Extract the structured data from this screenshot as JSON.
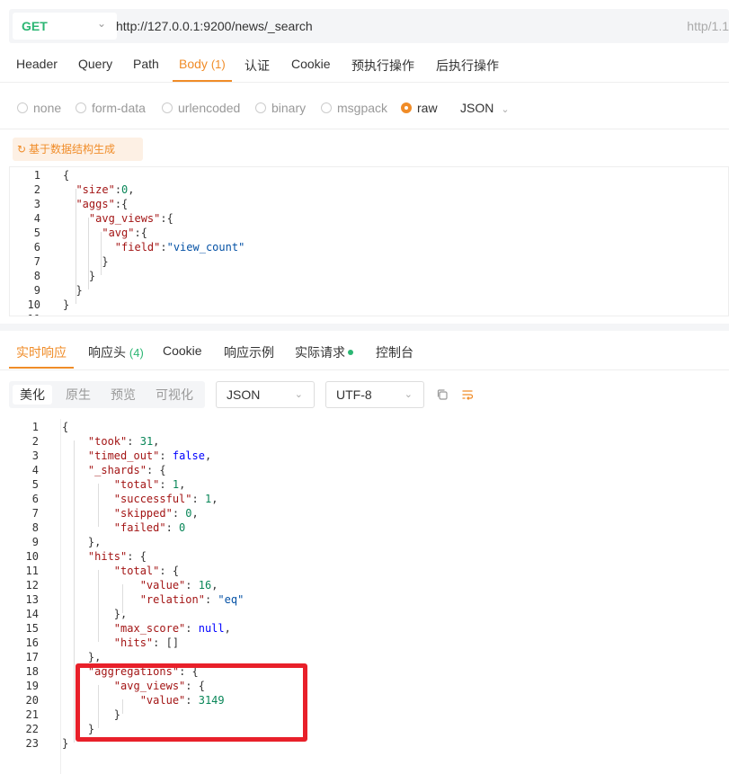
{
  "url_bar": {
    "method": "GET",
    "url": "http://127.0.0.1:9200/news/_search",
    "right_text": "http/1.1"
  },
  "request_tabs": [
    {
      "label": "Header",
      "count": ""
    },
    {
      "label": "Query",
      "count": ""
    },
    {
      "label": "Path",
      "count": ""
    },
    {
      "label": "Body",
      "count": "(1)"
    },
    {
      "label": "认证",
      "count": ""
    },
    {
      "label": "Cookie",
      "count": ""
    },
    {
      "label": "预执行操作",
      "count": ""
    },
    {
      "label": "后执行操作",
      "count": ""
    }
  ],
  "active_request_tab": "Body",
  "body_types": [
    "none",
    "form-data",
    "urlencoded",
    "binary",
    "msgpack",
    "raw"
  ],
  "selected_body_type": "raw",
  "raw_format": "JSON",
  "generate_button": "基于数据结构生成",
  "request_body": [
    {
      "n": "1",
      "t": [
        [
          "p",
          "{"
        ]
      ]
    },
    {
      "n": "2",
      "t": [
        [
          "p",
          "  "
        ],
        [
          "k",
          "\"size\""
        ],
        [
          "p",
          ":"
        ],
        [
          "n",
          "0"
        ],
        [
          "p",
          ","
        ]
      ]
    },
    {
      "n": "3",
      "t": [
        [
          "p",
          "  "
        ],
        [
          "k",
          "\"aggs\""
        ],
        [
          "p",
          ":{"
        ]
      ]
    },
    {
      "n": "4",
      "t": [
        [
          "p",
          "    "
        ],
        [
          "k",
          "\"avg_views\""
        ],
        [
          "p",
          ":{"
        ]
      ]
    },
    {
      "n": "5",
      "t": [
        [
          "p",
          "      "
        ],
        [
          "k",
          "\"avg\""
        ],
        [
          "p",
          ":{"
        ]
      ]
    },
    {
      "n": "6",
      "t": [
        [
          "p",
          "        "
        ],
        [
          "k",
          "\"field\""
        ],
        [
          "p",
          ":"
        ],
        [
          "s",
          "\"view_count\""
        ]
      ]
    },
    {
      "n": "7",
      "t": [
        [
          "p",
          "      }"
        ]
      ]
    },
    {
      "n": "8",
      "t": [
        [
          "p",
          "    }"
        ]
      ]
    },
    {
      "n": "9",
      "t": [
        [
          "p",
          "  }"
        ]
      ]
    },
    {
      "n": "10",
      "t": [
        [
          "p",
          "}"
        ]
      ]
    },
    {
      "n": "11",
      "t": [
        [
          "p",
          ""
        ]
      ]
    }
  ],
  "response_tabs": [
    {
      "label": "实时响应",
      "count": ""
    },
    {
      "label": "响应头",
      "count": "(4)"
    },
    {
      "label": "Cookie",
      "count": ""
    },
    {
      "label": "响应示例",
      "count": ""
    },
    {
      "label": "实际请求",
      "count": ""
    },
    {
      "label": "控制台",
      "count": ""
    }
  ],
  "active_response_tab": "实时响应",
  "view_modes": [
    "美化",
    "原生",
    "预览",
    "可视化"
  ],
  "active_view_mode": "美化",
  "response_format": "JSON",
  "response_encoding": "UTF-8",
  "toolbar_icons": [
    "copy-icon",
    "wrap-icon"
  ],
  "response_body": [
    {
      "n": "1",
      "t": [
        [
          "p",
          "{"
        ]
      ]
    },
    {
      "n": "2",
      "t": [
        [
          "p",
          "    "
        ],
        [
          "k",
          "\"took\""
        ],
        [
          "p",
          ": "
        ],
        [
          "n",
          "31"
        ],
        [
          "p",
          ","
        ]
      ]
    },
    {
      "n": "3",
      "t": [
        [
          "p",
          "    "
        ],
        [
          "k",
          "\"timed_out\""
        ],
        [
          "p",
          ": "
        ],
        [
          "kw",
          "false"
        ],
        [
          "p",
          ","
        ]
      ]
    },
    {
      "n": "4",
      "t": [
        [
          "p",
          "    "
        ],
        [
          "k",
          "\"_shards\""
        ],
        [
          "p",
          ": {"
        ]
      ]
    },
    {
      "n": "5",
      "t": [
        [
          "p",
          "        "
        ],
        [
          "k",
          "\"total\""
        ],
        [
          "p",
          ": "
        ],
        [
          "n",
          "1"
        ],
        [
          "p",
          ","
        ]
      ]
    },
    {
      "n": "6",
      "t": [
        [
          "p",
          "        "
        ],
        [
          "k",
          "\"successful\""
        ],
        [
          "p",
          ": "
        ],
        [
          "n",
          "1"
        ],
        [
          "p",
          ","
        ]
      ]
    },
    {
      "n": "7",
      "t": [
        [
          "p",
          "        "
        ],
        [
          "k",
          "\"skipped\""
        ],
        [
          "p",
          ": "
        ],
        [
          "n",
          "0"
        ],
        [
          "p",
          ","
        ]
      ]
    },
    {
      "n": "8",
      "t": [
        [
          "p",
          "        "
        ],
        [
          "k",
          "\"failed\""
        ],
        [
          "p",
          ": "
        ],
        [
          "n",
          "0"
        ]
      ]
    },
    {
      "n": "9",
      "t": [
        [
          "p",
          "    },"
        ]
      ]
    },
    {
      "n": "10",
      "t": [
        [
          "p",
          "    "
        ],
        [
          "k",
          "\"hits\""
        ],
        [
          "p",
          ": {"
        ]
      ]
    },
    {
      "n": "11",
      "t": [
        [
          "p",
          "        "
        ],
        [
          "k",
          "\"total\""
        ],
        [
          "p",
          ": {"
        ]
      ]
    },
    {
      "n": "12",
      "t": [
        [
          "p",
          "            "
        ],
        [
          "k",
          "\"value\""
        ],
        [
          "p",
          ": "
        ],
        [
          "n",
          "16"
        ],
        [
          "p",
          ","
        ]
      ]
    },
    {
      "n": "13",
      "t": [
        [
          "p",
          "            "
        ],
        [
          "k",
          "\"relation\""
        ],
        [
          "p",
          ": "
        ],
        [
          "s",
          "\"eq\""
        ]
      ]
    },
    {
      "n": "14",
      "t": [
        [
          "p",
          "        },"
        ]
      ]
    },
    {
      "n": "15",
      "t": [
        [
          "p",
          "        "
        ],
        [
          "k",
          "\"max_score\""
        ],
        [
          "p",
          ": "
        ],
        [
          "kw",
          "null"
        ],
        [
          "p",
          ","
        ]
      ]
    },
    {
      "n": "16",
      "t": [
        [
          "p",
          "        "
        ],
        [
          "k",
          "\"hits\""
        ],
        [
          "p",
          ": []"
        ]
      ]
    },
    {
      "n": "17",
      "t": [
        [
          "p",
          "    },"
        ]
      ]
    },
    {
      "n": "18",
      "t": [
        [
          "p",
          "    "
        ],
        [
          "k",
          "\"aggregations\""
        ],
        [
          "p",
          ": {"
        ]
      ]
    },
    {
      "n": "19",
      "t": [
        [
          "p",
          "        "
        ],
        [
          "k",
          "\"avg_views\""
        ],
        [
          "p",
          ": {"
        ]
      ]
    },
    {
      "n": "20",
      "t": [
        [
          "p",
          "            "
        ],
        [
          "k",
          "\"value\""
        ],
        [
          "p",
          ": "
        ],
        [
          "n",
          "3149"
        ]
      ]
    },
    {
      "n": "21",
      "t": [
        [
          "p",
          "        }"
        ]
      ]
    },
    {
      "n": "22",
      "t": [
        [
          "p",
          "    }"
        ]
      ]
    },
    {
      "n": "23",
      "t": [
        [
          "p",
          "}"
        ]
      ]
    }
  ]
}
